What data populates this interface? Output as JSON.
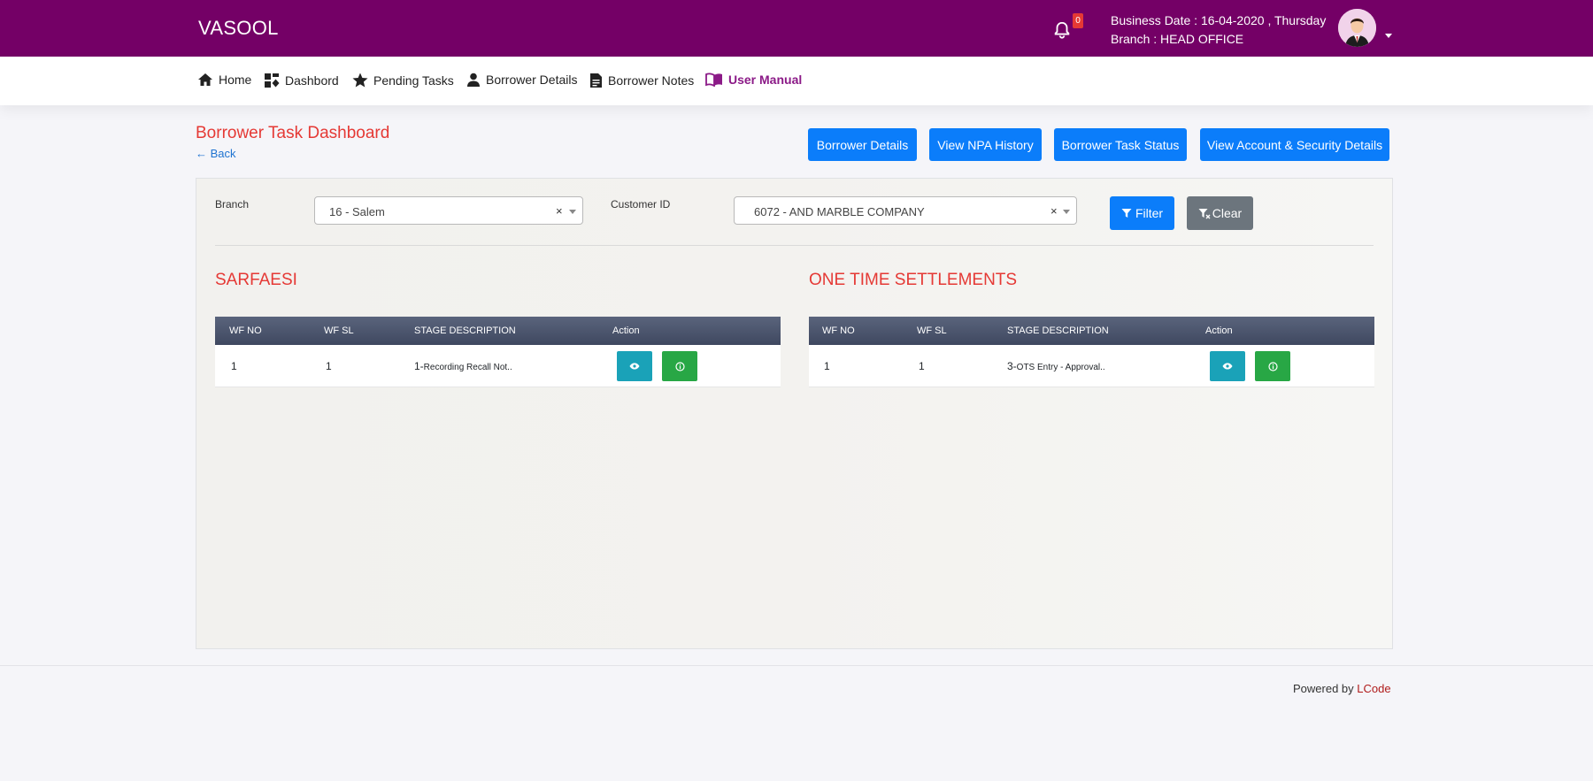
{
  "app": {
    "brand": "VASOOL"
  },
  "header": {
    "notifications_count": "0",
    "business_date_label": "Business Date : ",
    "business_date": "16-04-2020 , Thursday",
    "branch_label": "Branch : ",
    "branch": "HEAD OFFICE"
  },
  "nav": {
    "items": [
      {
        "label": "Home",
        "icon": "home-icon"
      },
      {
        "label": "Dashbord",
        "icon": "dashboard-icon"
      },
      {
        "label": "Pending Tasks",
        "icon": "star-icon"
      },
      {
        "label": "Borrower Details",
        "icon": "user-icon"
      },
      {
        "label": "Borrower Notes",
        "icon": "document-icon"
      },
      {
        "label": "User Manual",
        "icon": "book-icon"
      }
    ]
  },
  "page": {
    "title": "Borrower Task Dashboard",
    "back_label": "← Back"
  },
  "actions": {
    "borrower_details": "Borrower Details",
    "npa_history": "View NPA History",
    "task_status": "Borrower Task Status",
    "account_security": "View Account & Security Details"
  },
  "filters": {
    "branch_label": "Branch",
    "branch_value": "16 - Salem",
    "customer_label": "Customer ID",
    "customer_value": "6072  - AND MARBLE COMPANY",
    "filter_label": "Filter",
    "clear_label": "Clear"
  },
  "sarfaesi": {
    "title": "SARFAESI",
    "columns": [
      "WF NO",
      "WF SL",
      "STAGE DESCRIPTION",
      "Action"
    ],
    "rows": [
      {
        "wf_no": "1",
        "wf_sl": "1",
        "stage_num": "1-",
        "stage_desc": "Recording Recall Not.."
      }
    ]
  },
  "ots": {
    "title": "ONE TIME SETTLEMENTS",
    "columns": [
      "WF NO",
      "WF SL",
      "STAGE DESCRIPTION",
      "Action"
    ],
    "rows": [
      {
        "wf_no": "1",
        "wf_sl": "1",
        "stage_num": "3-",
        "stage_desc": "OTS Entry - Approval.."
      }
    ]
  },
  "footer": {
    "powered_by": "Powered by ",
    "company": "LCode"
  },
  "colors": {
    "header_bg": "#740066",
    "accent_red": "#e53935",
    "primary_blue": "#0b7dfa",
    "view_teal": "#1aa2b8",
    "info_green": "#28a745",
    "clear_gray": "#6c757d"
  }
}
